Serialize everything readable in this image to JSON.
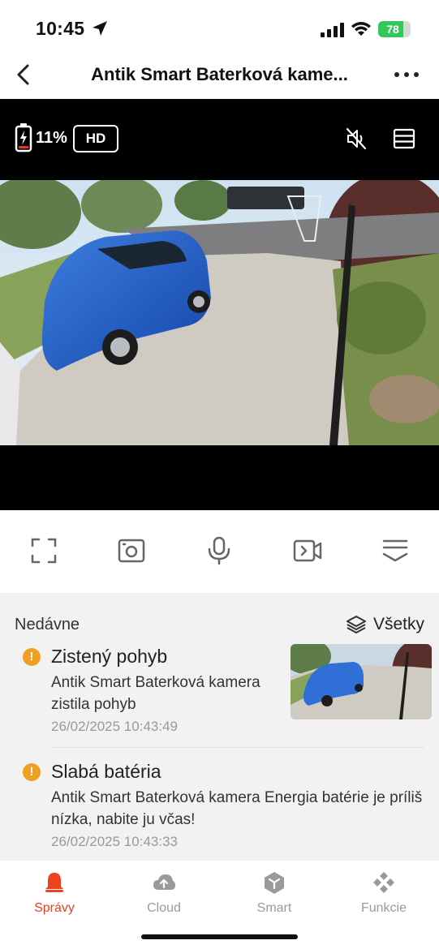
{
  "status_bar": {
    "time": "10:45",
    "battery_level": "78"
  },
  "nav": {
    "title": "Antik Smart Baterková kame..."
  },
  "camera": {
    "battery_percent": "11%",
    "quality_badge": "HD"
  },
  "recent": {
    "title": "Nedávne",
    "all_label": "Všetky",
    "events": [
      {
        "title": "Zistený pohyb",
        "description": "Antik Smart Baterková kamera zistila pohyb",
        "timestamp": "26/02/2025 10:43:49"
      },
      {
        "title": "Slabá batéria",
        "description": "Antik Smart Baterková kamera Energia batérie je príliš nízka, nabite ju včas!",
        "timestamp": "26/02/2025 10:43:33"
      }
    ]
  },
  "tabs": [
    {
      "label": "Správy",
      "icon": "bell-icon",
      "active": true
    },
    {
      "label": "Cloud",
      "icon": "cloud-upload-icon",
      "active": false
    },
    {
      "label": "Smart",
      "icon": "smart-cube-icon",
      "active": false
    },
    {
      "label": "Funkcie",
      "icon": "diamond-grid-icon",
      "active": false
    }
  ],
  "colors": {
    "accent": "#f0411e",
    "warning": "#f0a020",
    "tab_inactive": "#9a9a9a",
    "battery_green": "#34c759"
  }
}
